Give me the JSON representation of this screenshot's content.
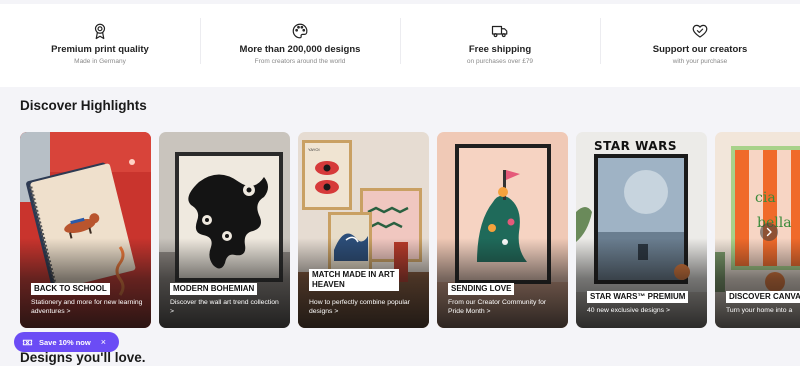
{
  "usps": [
    {
      "icon": "award-icon",
      "title": "Premium print quality",
      "subtitle": "Made in Germany"
    },
    {
      "icon": "palette-icon",
      "title": "More than 200,000 designs",
      "subtitle": "From creators around the world"
    },
    {
      "icon": "truck-icon",
      "title": "Free shipping",
      "subtitle": "on purchases over £79"
    },
    {
      "icon": "heart-handshake-icon",
      "title": "Support our creators",
      "subtitle": "with your purchase"
    }
  ],
  "highlights": {
    "title": "Discover Highlights",
    "cards": [
      {
        "label": "BACK TO SCHOOL",
        "description": "Stationery and more for new learning adventures >"
      },
      {
        "label": "MODERN BOHEMIAN",
        "description": "Discover the wall art trend collection >"
      },
      {
        "label": "MATCH MADE IN ART HEAVEN",
        "description": "How to perfectly combine popular designs >"
      },
      {
        "label": "SENDING LOVE",
        "description": "From our Creator Community for Pride Month >"
      },
      {
        "label": "STAR WARS™ PREMIUM",
        "description": "40 new exclusive designs >",
        "poster_title": "STAR WARS"
      },
      {
        "label": "DISCOVER CANVA",
        "description": "Turn your home into a"
      }
    ],
    "next_arrow": "chevron-right-icon"
  },
  "promo": {
    "label": "Save 10% now",
    "close": "×"
  },
  "designs": {
    "title": "Designs you'll love."
  },
  "colors": {
    "promo": "#6b4cf5",
    "background": "#f4f4f8"
  }
}
